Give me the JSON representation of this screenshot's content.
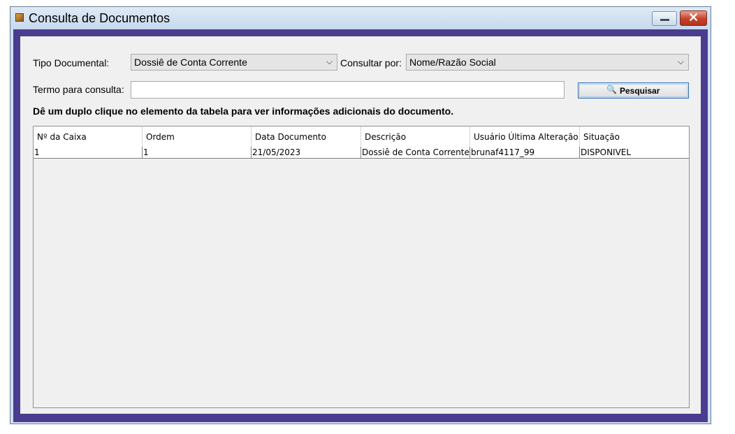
{
  "window": {
    "title": "Consulta de Documentos",
    "minimize_icon": "minimize-icon",
    "close_icon": "close-icon",
    "close_glyph": "✕"
  },
  "filters": {
    "tipo_label": "Tipo Documental:",
    "tipo_value": "Dossiê de Conta Corrente",
    "consultar_label": "Consultar por:",
    "consultar_value": "Nome/Razão Social",
    "termo_label": "Termo para consulta:",
    "termo_value": "",
    "search_button": "Pesquisar",
    "search_icon": "magnifier-icon",
    "dropdown_arrow": "⌵"
  },
  "hint": "Dê um duplo clique no elemento da tabela para ver informações adicionais do documento.",
  "table": {
    "columns": [
      "Nº da Caixa",
      "Ordem",
      "Data Documento",
      "Descrição",
      "Usuário Última Alteração",
      "Situação"
    ],
    "rows": [
      [
        "1",
        "1",
        "21/05/2023",
        "Dossiê de Conta Corrente",
        "brunaf4117_99",
        "DISPONIVEL"
      ]
    ]
  },
  "colors": {
    "frame": "#4a3d8f",
    "titlebar": "#cfe0f2",
    "close": "#c5412a"
  }
}
